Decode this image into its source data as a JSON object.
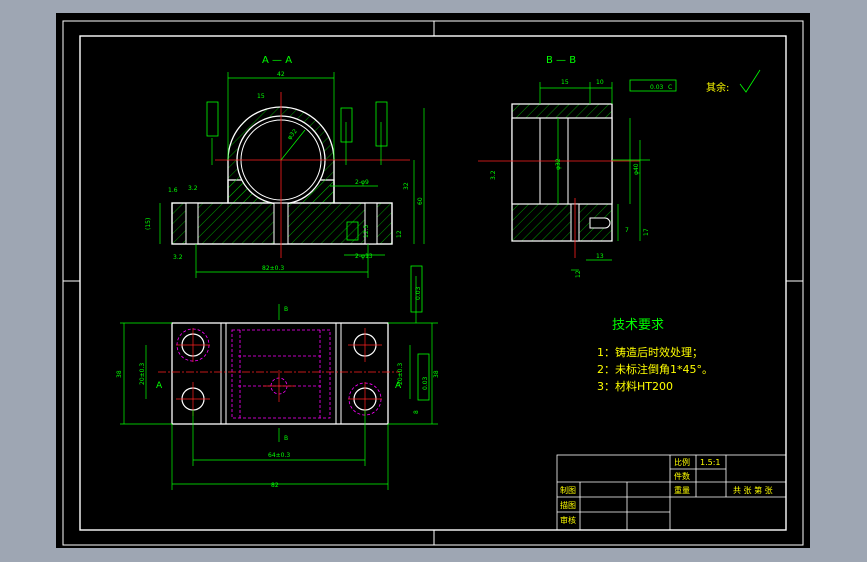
{
  "views": {
    "section_aa": "A — A",
    "section_bb": "B — B",
    "rest_roughness": "其余:"
  },
  "dims_aa": {
    "d_top": "42",
    "d_bore": "φ32",
    "d_left1": "(15)",
    "d_left2": "3.2",
    "d_h": "60",
    "d_width": "82±0.3",
    "d_r": "15",
    "d_slot": "2-φ9",
    "d_slot2": "2-φ13",
    "d_32": "32",
    "d_12": "12",
    "d_12_5": "12.5",
    "rough_1_6": "1.6",
    "rough_3_2": "3.2"
  },
  "dims_bb": {
    "d_15": "15",
    "d_10": "10",
    "d_32": "φ32",
    "d_40": "φ40",
    "d_12": "12",
    "d_13": "13",
    "d_7": "7",
    "d_17": "17",
    "tol": "0.03",
    "datum": "C",
    "rough": "3.2"
  },
  "dims_top": {
    "d_82": "82",
    "d_64": "64±0.3",
    "d_38": "38",
    "d_20": "20±0.3",
    "d_38b": "38",
    "d_20b": "20±0.3",
    "d_8": "8",
    "tol": "0.03",
    "datum": "C",
    "label_a": "A",
    "label_b": "B"
  },
  "tech": {
    "title": "技术要求",
    "items": [
      "1：铸造后时效处理；",
      "2：未标注倒角1*45°。",
      "3：材料HT200"
    ]
  },
  "title_block": {
    "scale_label": "比例",
    "scale_value": "1.5:1",
    "qty_label": "件数",
    "weight_label": "重量",
    "sheets_label": "共 张 第 张",
    "drawn_label": "制图",
    "design_label": "描图",
    "check_label": "审核"
  },
  "colors": {
    "background": "#9ea6b3",
    "sheet": "#000000",
    "line": "#ffffff",
    "dimension": "#00ff00",
    "center": "#ff0000",
    "hidden": "#ff00ff",
    "hatch": "#00ff00"
  }
}
